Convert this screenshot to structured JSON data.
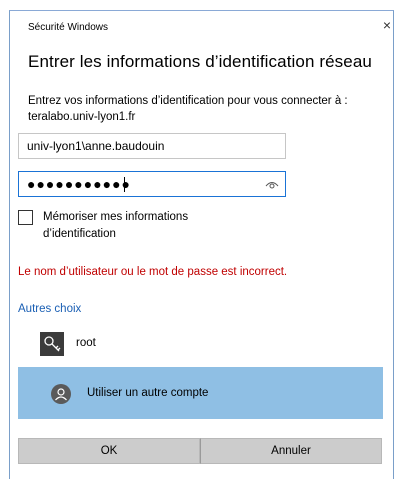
{
  "window": {
    "title": "Sécurité Windows",
    "close_glyph": "×"
  },
  "dialog": {
    "heading": "Entrer les informations d’identification réseau",
    "description": "Entrez vos informations d’identification pour vous connecter à : teralabo.univ-lyon1.fr"
  },
  "form": {
    "username_value": "univ-lyon1\\anne.baudouin",
    "password_masked": "●●●●●●●●●●●",
    "password_icon": "eye-icon",
    "remember_label": "Mémoriser mes informations d’identification",
    "remember_checked": false
  },
  "error_message": "Le nom d’utilisateur ou le mot de passe est incorrect.",
  "error_color": "#c00000",
  "more_choices": {
    "label": "Autres choix",
    "accounts": [
      {
        "label": "root",
        "icon": "key-icon"
      },
      {
        "label": "Utiliser un autre compte",
        "icon": "user-icon",
        "selected": true
      }
    ]
  },
  "buttons": {
    "ok_label": "OK",
    "cancel_label": "Annuler"
  },
  "colors": {
    "selection": "#8fbfe4",
    "link": "#1a5fb4",
    "focus_border": "#1a73d6"
  }
}
